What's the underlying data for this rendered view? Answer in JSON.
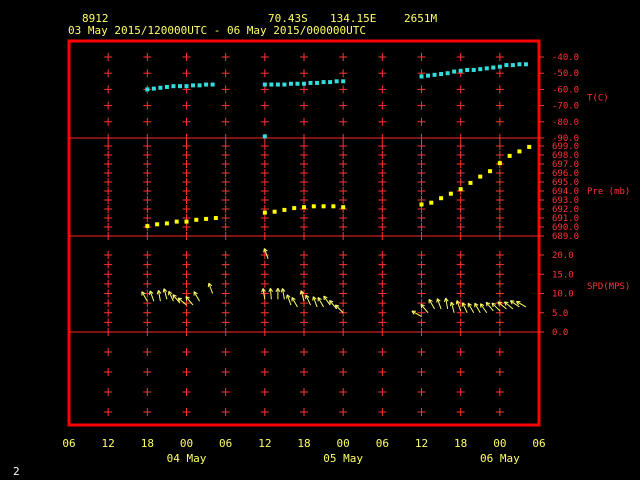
{
  "header": {
    "station_id": "8912",
    "lat": "70.43S",
    "lon": "134.15E",
    "elev": "2651M",
    "time_range": "03 May 2015/120000UTC - 06 May 2015/000000UTC"
  },
  "page_number": "2",
  "colors": {
    "frame": "#ff0000",
    "grid": "#ff3333",
    "temp_series": "#33dddd",
    "pressure_series": "#ffff00",
    "wind_series": "#ffff66",
    "text": "#ffff66"
  },
  "chart_data": [
    {
      "type": "scatter",
      "panel": "temperature",
      "ylabel": "T(C)",
      "ylim": [
        -90,
        -40
      ],
      "yticks": [
        "-40.0",
        "-50.0",
        "-60.0",
        "-70.0",
        "-80.0",
        "-90.0"
      ],
      "x_unit": "hours since 03 May 2015 06 UTC",
      "series": [
        {
          "name": "T(C)",
          "x": [
            12,
            13,
            14,
            15,
            16,
            17,
            18,
            19,
            20,
            21,
            22,
            30,
            31,
            32,
            33,
            34,
            35,
            36,
            37,
            38,
            39,
            40,
            41,
            42,
            54,
            55,
            56,
            57,
            58,
            59,
            60,
            61,
            62,
            63,
            64,
            65,
            66,
            67,
            68,
            69,
            70
          ],
          "values": [
            -60,
            -59.5,
            -59,
            -58.5,
            -58,
            -58,
            -58,
            -57.5,
            -57.5,
            -57,
            -57,
            -57,
            -57,
            -57,
            -57,
            -56.5,
            -56.5,
            -56.5,
            -56,
            -56,
            -55.5,
            -55.5,
            -55,
            -55,
            -52,
            -51.5,
            -51,
            -50.5,
            -50,
            -49,
            -48.5,
            -48,
            -48,
            -47.5,
            -47,
            -46.5,
            -46,
            -45,
            -45,
            -44.5,
            -44.5
          ]
        },
        {
          "name": "T(C) outlier",
          "x": [
            30
          ],
          "values": [
            -89
          ]
        }
      ]
    },
    {
      "type": "scatter",
      "panel": "pressure",
      "ylabel": "Pre (mb)",
      "ylim": [
        689,
        699
      ],
      "yticks": [
        "699.0",
        "698.0",
        "697.0",
        "696.0",
        "695.0",
        "694.0",
        "693.0",
        "692.0",
        "691.0",
        "690.0",
        "689.0"
      ],
      "series": [
        {
          "name": "Pre (mb)",
          "x": [
            12,
            13.5,
            15,
            16.5,
            18,
            19.5,
            21,
            22.5,
            30,
            31.5,
            33,
            34.5,
            36,
            37.5,
            39,
            40.5,
            42,
            54,
            55.5,
            57,
            58.5,
            60,
            61.5,
            63,
            64.5,
            66,
            67.5,
            69,
            70.5
          ],
          "values": [
            690.1,
            690.3,
            690.4,
            690.6,
            690.6,
            690.8,
            690.9,
            691.0,
            691.6,
            691.7,
            691.9,
            692.1,
            692.2,
            692.3,
            692.3,
            692.3,
            692.2,
            692.5,
            692.7,
            693.2,
            693.7,
            694.2,
            694.9,
            695.6,
            696.2,
            697.1,
            697.9,
            698.4,
            698.9
          ]
        }
      ]
    },
    {
      "type": "scatter",
      "panel": "wind",
      "ylabel": "SPD(MPS)",
      "ylim": [
        0,
        20
      ],
      "yticks": [
        "20.0",
        "15.0",
        "10.0",
        "5.0",
        "0.0"
      ],
      "series": [
        {
          "name": "SPD(MPS)",
          "x": [
            12,
            13,
            14,
            15,
            16,
            17,
            18,
            19,
            20,
            22,
            30,
            31,
            32,
            33,
            34,
            35,
            36,
            37,
            38,
            39,
            40,
            41,
            42,
            30.5,
            54,
            55,
            56,
            57,
            58,
            59,
            60,
            61,
            62,
            63,
            64,
            65,
            66,
            67,
            68,
            69,
            70
          ],
          "values": [
            8,
            8,
            8,
            8.5,
            8,
            7.5,
            7,
            7,
            8,
            10,
            8.5,
            8.5,
            8.5,
            8.5,
            7,
            6.5,
            8,
            7,
            6.5,
            6.5,
            7,
            6,
            5,
            19,
            4,
            5,
            6,
            6,
            6,
            5,
            5.5,
            5,
            5,
            5,
            5,
            5.5,
            5.5,
            6,
            6,
            6.5,
            6.5
          ],
          "directions_deg": [
            330,
            340,
            350,
            345,
            335,
            320,
            310,
            320,
            330,
            340,
            350,
            355,
            0,
            350,
            340,
            330,
            345,
            335,
            340,
            330,
            325,
            320,
            315,
            340,
            300,
            320,
            330,
            340,
            350,
            345,
            340,
            335,
            330,
            330,
            325,
            320,
            315,
            310,
            310,
            305,
            300
          ]
        }
      ]
    }
  ],
  "x_axis": {
    "tick_labels": [
      "06",
      "12",
      "18",
      "00",
      "06",
      "12",
      "18",
      "00",
      "06",
      "12",
      "18",
      "00",
      "06"
    ],
    "tick_hours": [
      0,
      6,
      12,
      18,
      24,
      30,
      36,
      42,
      48,
      54,
      60,
      66,
      72
    ],
    "date_labels": [
      {
        "label": "04 May",
        "hour": 18
      },
      {
        "label": "05 May",
        "hour": 42
      },
      {
        "label": "06 May",
        "hour": 66
      }
    ]
  }
}
